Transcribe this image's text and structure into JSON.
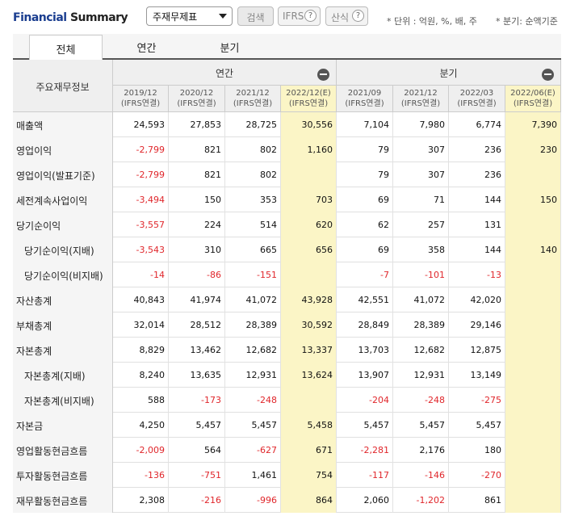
{
  "header": {
    "title_main": "Financial",
    "title_sub": " Summary",
    "select_value": "주재무제표",
    "search_label": "검색",
    "ifrs_label": "IFRS",
    "calc_label": "산식",
    "help_symbol": "?",
    "unit_note": "* 단위 : 억원, %, 배, 주",
    "quarter_note": "* 분기: 순액기준"
  },
  "tabs": [
    {
      "label": "전체"
    },
    {
      "label": "연간"
    },
    {
      "label": "분기"
    }
  ],
  "table": {
    "corner_label": "주요재무정보",
    "group_annual": "연간",
    "group_quarter": "분기",
    "columns": [
      {
        "period": "2019/12",
        "basis": "(IFRS연결)",
        "estimate": false
      },
      {
        "period": "2020/12",
        "basis": "(IFRS연결)",
        "estimate": false
      },
      {
        "period": "2021/12",
        "basis": "(IFRS연결)",
        "estimate": false
      },
      {
        "period": "2022/12(E)",
        "basis": "(IFRS연결)",
        "estimate": true
      },
      {
        "period": "2021/09",
        "basis": "(IFRS연결)",
        "estimate": false
      },
      {
        "period": "2021/12",
        "basis": "(IFRS연결)",
        "estimate": false
      },
      {
        "period": "2022/03",
        "basis": "(IFRS연결)",
        "estimate": false
      },
      {
        "period": "2022/06(E)",
        "basis": "(IFRS연결)",
        "estimate": true
      }
    ],
    "rows": [
      {
        "label": "매출액",
        "indent": false,
        "values": [
          "24,593",
          "27,853",
          "28,725",
          "30,556",
          "7,104",
          "7,980",
          "6,774",
          "7,390"
        ]
      },
      {
        "label": "영업이익",
        "indent": false,
        "values": [
          "-2,799",
          "821",
          "802",
          "1,160",
          "79",
          "307",
          "236",
          "230"
        ]
      },
      {
        "label": "영업이익(발표기준)",
        "indent": false,
        "values": [
          "-2,799",
          "821",
          "802",
          "",
          "79",
          "307",
          "236",
          ""
        ]
      },
      {
        "label": "세전계속사업이익",
        "indent": false,
        "values": [
          "-3,494",
          "150",
          "353",
          "703",
          "69",
          "71",
          "144",
          "150"
        ]
      },
      {
        "label": "당기순이익",
        "indent": false,
        "values": [
          "-3,557",
          "224",
          "514",
          "620",
          "62",
          "257",
          "131",
          ""
        ]
      },
      {
        "label": "당기순이익(지배)",
        "indent": true,
        "values": [
          "-3,543",
          "310",
          "665",
          "656",
          "69",
          "358",
          "144",
          "140"
        ]
      },
      {
        "label": "당기순이익(비지배)",
        "indent": true,
        "values": [
          "-14",
          "-86",
          "-151",
          "",
          "-7",
          "-101",
          "-13",
          ""
        ]
      },
      {
        "label": "자산총계",
        "indent": false,
        "values": [
          "40,843",
          "41,974",
          "41,072",
          "43,928",
          "42,551",
          "41,072",
          "42,020",
          ""
        ]
      },
      {
        "label": "부채총계",
        "indent": false,
        "values": [
          "32,014",
          "28,512",
          "28,389",
          "30,592",
          "28,849",
          "28,389",
          "29,146",
          ""
        ]
      },
      {
        "label": "자본총계",
        "indent": false,
        "values": [
          "8,829",
          "13,462",
          "12,682",
          "13,337",
          "13,703",
          "12,682",
          "12,875",
          ""
        ]
      },
      {
        "label": "자본총계(지배)",
        "indent": true,
        "values": [
          "8,240",
          "13,635",
          "12,931",
          "13,624",
          "13,907",
          "12,931",
          "13,149",
          ""
        ]
      },
      {
        "label": "자본총계(비지배)",
        "indent": true,
        "values": [
          "588",
          "-173",
          "-248",
          "",
          "-204",
          "-248",
          "-275",
          ""
        ]
      },
      {
        "label": "자본금",
        "indent": false,
        "values": [
          "4,250",
          "5,457",
          "5,457",
          "5,458",
          "5,457",
          "5,457",
          "5,457",
          ""
        ]
      },
      {
        "label": "영업활동현금흐름",
        "indent": false,
        "values": [
          "-2,009",
          "564",
          "-627",
          "671",
          "-2,281",
          "2,176",
          "180",
          ""
        ]
      },
      {
        "label": "투자활동현금흐름",
        "indent": false,
        "values": [
          "-136",
          "-751",
          "1,461",
          "754",
          "-117",
          "-146",
          "-270",
          ""
        ]
      },
      {
        "label": "재무활동현금흐름",
        "indent": false,
        "values": [
          "2,308",
          "-216",
          "-996",
          "864",
          "2,060",
          "-1,202",
          "861",
          ""
        ]
      }
    ]
  },
  "colors": {
    "title_blue": "#1a3d8f",
    "negative_red": "#e0262b",
    "estimate_bg": "#fbf5c6"
  }
}
